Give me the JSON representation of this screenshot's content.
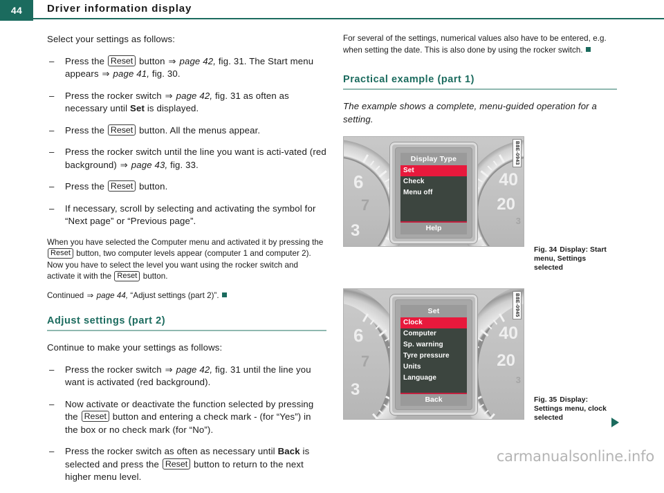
{
  "header": {
    "page_number": "44",
    "title": "Driver information display",
    "accent_color": "#1b6b5e"
  },
  "left_column": {
    "intro": "Select your settings as follows:",
    "bullets": [
      {
        "dash": "–",
        "parts": [
          {
            "t": "Press the "
          },
          {
            "t": "Reset",
            "style": "keycap"
          },
          {
            "t": " button "
          },
          {
            "t": "⇒",
            "style": "arrow"
          },
          {
            "t": " page 42,",
            "style": "italic"
          },
          {
            "t": " fig. 31. The Start menu appears "
          },
          {
            "t": "⇒",
            "style": "arrow"
          },
          {
            "t": " page 41,",
            "style": "italic"
          },
          {
            "t": " fig. 30."
          }
        ]
      },
      {
        "dash": "–",
        "parts": [
          {
            "t": "Press the rocker switch "
          },
          {
            "t": "⇒",
            "style": "arrow"
          },
          {
            "t": " page 42,",
            "style": "italic"
          },
          {
            "t": " fig. 31 as often as necessary until "
          },
          {
            "t": "Set",
            "style": "bold"
          },
          {
            "t": " is displayed."
          }
        ]
      },
      {
        "dash": "–",
        "parts": [
          {
            "t": "Press the "
          },
          {
            "t": "Reset",
            "style": "keycap"
          },
          {
            "t": " button. All the menus appear."
          }
        ]
      },
      {
        "dash": "–",
        "parts": [
          {
            "t": "Press the rocker switch until the line you want is acti-vated (red background) "
          },
          {
            "t": "⇒",
            "style": "arrow"
          },
          {
            "t": " page 43,",
            "style": "italic"
          },
          {
            "t": " fig. 33."
          }
        ]
      },
      {
        "dash": "–",
        "parts": [
          {
            "t": "Press the "
          },
          {
            "t": "Reset",
            "style": "keycap"
          },
          {
            "t": " button."
          }
        ]
      },
      {
        "dash": "–",
        "parts": [
          {
            "t": "If necessary, scroll by selecting and activating the symbol for “Next page” or “Previous page”."
          }
        ]
      }
    ],
    "note_parts": [
      {
        "t": "When you have selected the Computer menu and activated it by pressing the "
      },
      {
        "t": "Reset",
        "style": "keycap-sm"
      },
      {
        "t": " button, two computer levels appear (computer 1 and computer 2). Now you have to select the level you want using the rocker switch and activate it with the "
      },
      {
        "t": "Reset",
        "style": "keycap-sm"
      },
      {
        "t": " button."
      }
    ],
    "continued_parts": [
      {
        "t": "Continued "
      },
      {
        "t": "⇒",
        "style": "arrow"
      },
      {
        "t": " page 44,",
        "style": "italic"
      },
      {
        "t": " “Adjust settings (part 2)”."
      },
      {
        "t": "",
        "style": "endmark"
      }
    ],
    "section_heading": "Adjust settings (part 2)",
    "section_intro": "Continue to make your settings as follows:",
    "section_bullets": [
      {
        "dash": "–",
        "parts": [
          {
            "t": "Press the rocker switch "
          },
          {
            "t": "⇒",
            "style": "arrow"
          },
          {
            "t": " page 42,",
            "style": "italic"
          },
          {
            "t": " fig. 31 until the line you want is activated (red background)."
          }
        ]
      },
      {
        "dash": "–",
        "parts": [
          {
            "t": "Now activate or deactivate the function selected by pressing the "
          },
          {
            "t": "Reset",
            "style": "keycap"
          },
          {
            "t": " button and entering a check mark - (for “Yes”) in the box or no check mark (for “No”)."
          }
        ]
      },
      {
        "dash": "–",
        "parts": [
          {
            "t": "Press the rocker switch as often as necessary until "
          },
          {
            "t": "Back",
            "style": "bold"
          },
          {
            "t": " is selected and press the "
          },
          {
            "t": "Reset",
            "style": "keycap"
          },
          {
            "t": " button to return to the next higher menu level."
          }
        ]
      }
    ]
  },
  "right_column": {
    "note_parts": [
      {
        "t": "For several of the settings, numerical values also have to be entered, e.g. when setting the date. This is also done by using the rocker switch."
      },
      {
        "t": "",
        "style": "endmark"
      }
    ],
    "section_heading": "Practical example (part 1)",
    "section_intro": "The example shows a complete, menu-guided operation for a setting."
  },
  "figures": [
    {
      "id": "fig-34",
      "image_code": "B8E-0943",
      "caption_number": "Fig. 34",
      "caption_text": "Display: Start menu, Settings selected",
      "screen": {
        "title": "Display Type",
        "items": [
          {
            "label": "Set",
            "selected": true
          },
          {
            "label": "Check",
            "selected": false
          },
          {
            "label": "Menu off",
            "selected": false
          }
        ],
        "footer": "Help"
      },
      "gauges": {
        "left_numbers": [
          "6",
          "7",
          "3"
        ],
        "right_numbers": [
          "40",
          "20",
          "3"
        ]
      }
    },
    {
      "id": "fig-35",
      "image_code": "B8E-0945",
      "caption_number": "Fig. 35",
      "caption_text": "Display: Settings menu, clock selected",
      "screen": {
        "title": "Set",
        "items": [
          {
            "label": "Clock",
            "selected": true
          },
          {
            "label": "Computer",
            "selected": false
          },
          {
            "label": "Sp. warning",
            "selected": false
          },
          {
            "label": "Tyre pressure",
            "selected": false
          },
          {
            "label": "Units",
            "selected": false
          },
          {
            "label": "Language",
            "selected": false
          }
        ],
        "footer": "Back"
      },
      "gauges": {
        "left_numbers": [
          "6",
          "7",
          "3"
        ],
        "right_numbers": [
          "40",
          "20",
          "3"
        ]
      }
    }
  ],
  "footer": {
    "watermark": "carmanualsonline.info"
  }
}
